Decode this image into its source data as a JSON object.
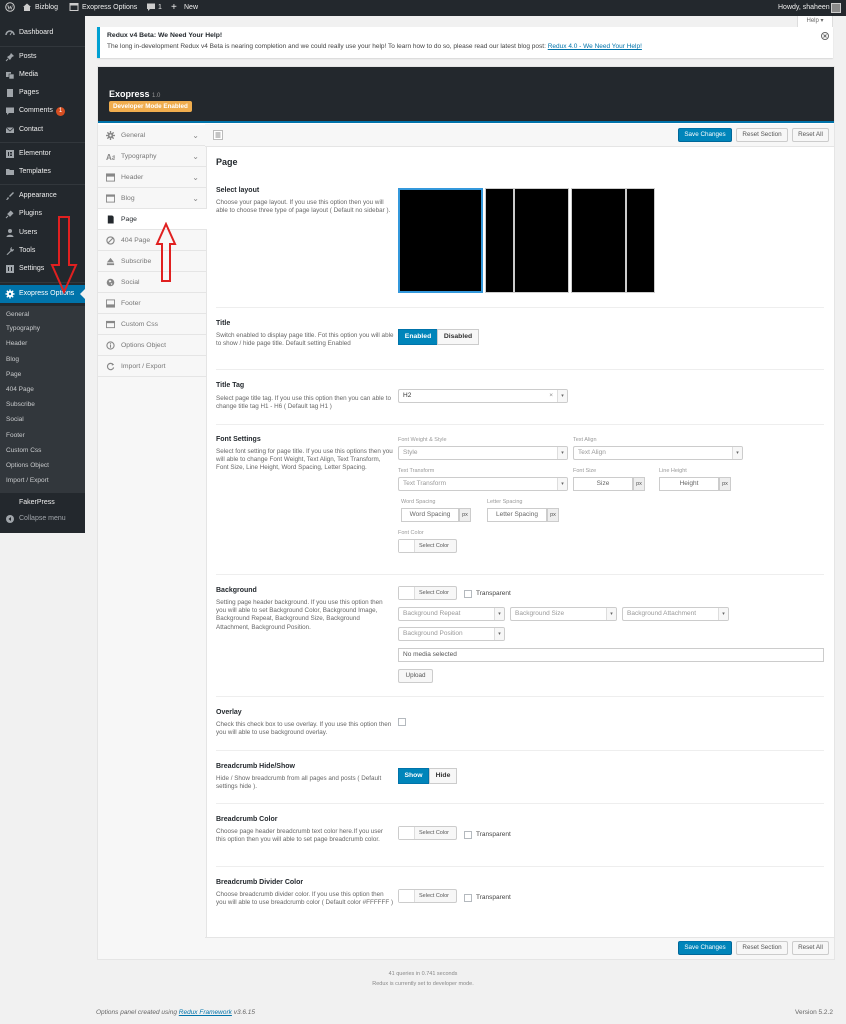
{
  "adminbar": {
    "site_name": "Bizblog",
    "plugin_link": "Exopress Options",
    "comments_count": "1",
    "new_label": "New",
    "greeting": "Howdy, shaheen"
  },
  "sidebar": {
    "items": [
      {
        "label": "Dashboard",
        "icon": "dashboard-icon"
      },
      {
        "label": "Posts",
        "icon": "pin-icon"
      },
      {
        "label": "Media",
        "icon": "media-icon"
      },
      {
        "label": "Pages",
        "icon": "page-icon"
      },
      {
        "label": "Comments",
        "icon": "comment-icon",
        "badge": "1"
      },
      {
        "label": "Contact",
        "icon": "mail-icon"
      },
      {
        "label": "Elementor",
        "icon": "elementor-icon"
      },
      {
        "label": "Templates",
        "icon": "folder-icon"
      },
      {
        "label": "Appearance",
        "icon": "brush-icon"
      },
      {
        "label": "Plugins",
        "icon": "plug-icon"
      },
      {
        "label": "Users",
        "icon": "user-icon"
      },
      {
        "label": "Tools",
        "icon": "wrench-icon"
      },
      {
        "label": "Settings",
        "icon": "settings-icon"
      },
      {
        "label": "Exopress Options",
        "icon": "gear-icon"
      }
    ],
    "submenu": [
      "General",
      "Typography",
      "Header",
      "Blog",
      "Page",
      "404 Page",
      "Subscribe",
      "Social",
      "Footer",
      "Custom Css",
      "Options Object",
      "Import / Export"
    ],
    "fakerpress": "FakerPress",
    "collapse": "Collapse menu"
  },
  "help_tab": "Help",
  "notice": {
    "title": "Redux v4 Beta: We Need Your Help!",
    "text": "The long in-development Redux v4 Beta is nearing completion and we could really use your help! To learn how to do so, please read our latest blog post:",
    "link": "Redux 4.0 - We Need Your Help!"
  },
  "panel": {
    "title": "Exopress",
    "version": "1.0",
    "dev_badge": "Developer Mode Enabled",
    "tabs": [
      {
        "label": "General",
        "icon": "gear-icon",
        "has_chevron": true
      },
      {
        "label": "Typography",
        "icon": "font-icon",
        "has_chevron": true
      },
      {
        "label": "Header",
        "icon": "header-icon",
        "has_chevron": true
      },
      {
        "label": "Blog",
        "icon": "blog-icon",
        "has_chevron": true
      },
      {
        "label": "Page",
        "icon": "page-icon",
        "active": true
      },
      {
        "label": "404 Page",
        "icon": "ban-icon"
      },
      {
        "label": "Subscribe",
        "icon": "eject-icon"
      },
      {
        "label": "Social",
        "icon": "globe-icon"
      },
      {
        "label": "Footer",
        "icon": "footer-icon"
      },
      {
        "label": "Custom Css",
        "icon": "code-icon"
      },
      {
        "label": "Options Object",
        "icon": "info-icon"
      },
      {
        "label": "Import / Export",
        "icon": "refresh-icon"
      }
    ],
    "buttons": {
      "save": "Save Changes",
      "reset_section": "Reset Section",
      "reset_all": "Reset All"
    },
    "section_title": "Page"
  },
  "fields": {
    "layout": {
      "title": "Select layout",
      "desc": "Choose your page layout. If you use this option then you will able to choose three type of page layout ( Default no sidebar )."
    },
    "title_toggle": {
      "title": "Title",
      "desc": "Switch enabled to display page title. Fot this option you will able to show / hide page title. Default setting Enabled",
      "on": "Enabled",
      "off": "Disabled"
    },
    "title_tag": {
      "title": "Title Tag",
      "desc": "Select page title tag. If you use this option then you can able to change title tag H1 - H6 ( Default tag H1 )",
      "value": "H2"
    },
    "font": {
      "title": "Font Settings",
      "desc": "Select font setting for page title. If you use this options then you will able to change Font Weight, Text Align, Text Transform, Font Size, Line Height, Word Spacing, Letter Spacing.",
      "weight_label": "Font Weight & Style",
      "weight_ph": "Style",
      "align_label": "Text Align",
      "align_ph": "Text Align",
      "transform_label": "Text Transform",
      "transform_ph": "Text Transform",
      "size_label": "Font Size",
      "size_ph": "Size",
      "lh_label": "Line Height",
      "lh_ph": "Height",
      "ws_label": "Word Spacing",
      "ws_ph": "Word Spacing",
      "ls_label": "Letter Spacing",
      "ls_ph": "Letter Spacing",
      "unit": "px",
      "color_label": "Font Color",
      "color_btn": "Select Color"
    },
    "background": {
      "title": "Background",
      "desc": "Setting page header background. If you use this option then you will able to set Background Color, Background Image, Background Repeat, Background Size, Background Attachment, Background Position.",
      "color_btn": "Select Color",
      "transparent": "Transparent",
      "repeat": "Background Repeat",
      "size": "Background Size",
      "attachment": "Background Attachment",
      "position": "Background Position",
      "media": "No media selected",
      "upload": "Upload"
    },
    "overlay": {
      "title": "Overlay",
      "desc": "Check this check box to use overlay. If you use this option then you will able to use background overlay."
    },
    "breadcrumb": {
      "title": "Breadcrumb Hide/Show",
      "desc": "Hide / Show breadcrumb from all pages and posts ( Default settings hide ).",
      "on": "Show",
      "off": "Hide"
    },
    "bc_color": {
      "title": "Breadcrumb Color",
      "desc": "Choose page header breadcrumb text color here.If you user this option then you will able to set page breadcrumb color.",
      "color_btn": "Select Color",
      "transparent": "Transparent"
    },
    "bc_divider": {
      "title": "Breadcrumb Divider Color",
      "desc": "Choose breadcrumb divider color. If you use this option then you will able to use breadcrumb color ( Default color #FFFFFF )",
      "color_btn": "Select Color",
      "transparent": "Transparent"
    }
  },
  "footer": {
    "queries": "41 queries in 0.741 seconds",
    "dev_mode": "Redux is currently set to developer mode.",
    "credit_prefix": "Options panel created using",
    "credit_link": "Redux Framework",
    "credit_version": "v3.6.15",
    "wp_version": "Version 5.2.2"
  },
  "colors": {
    "accent": "#0073aa",
    "button": "#0085ba",
    "badge": "#f0ad4e",
    "arrow": "#e02020",
    "dark": "#23282d"
  }
}
